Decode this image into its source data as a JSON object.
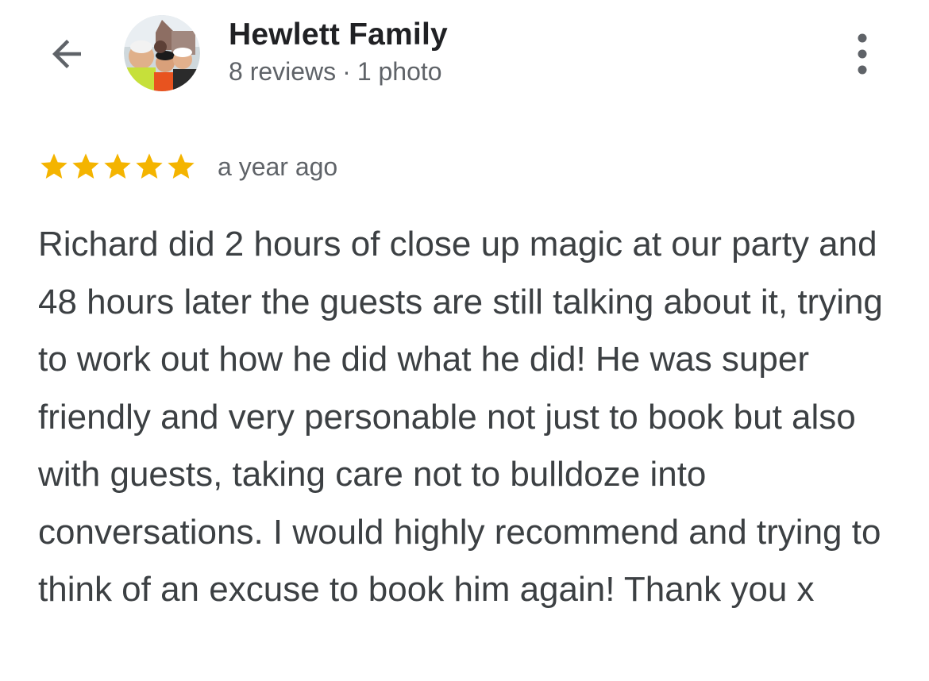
{
  "header": {
    "back_icon": "arrow-back-icon",
    "avatar_alt": "Hewlett Family profile photo",
    "reviewer_name": "Hewlett Family",
    "reviews_count": "8 reviews",
    "photos_count": "1 photo",
    "separator": "·",
    "more_icon": "more-vert-icon"
  },
  "review": {
    "rating": 5,
    "max_rating": 5,
    "star_color": "#f4b400",
    "time_ago": "a year ago",
    "text": "Richard did 2 hours of close up magic at our party and 48 hours later the guests are still talking about it, trying to work out how he did what he did! He was super friendly and very personable not just to book but also with guests, taking care not to bulldoze into conversations. I would highly recommend and trying to think of an excuse to book him again! Thank you x"
  }
}
